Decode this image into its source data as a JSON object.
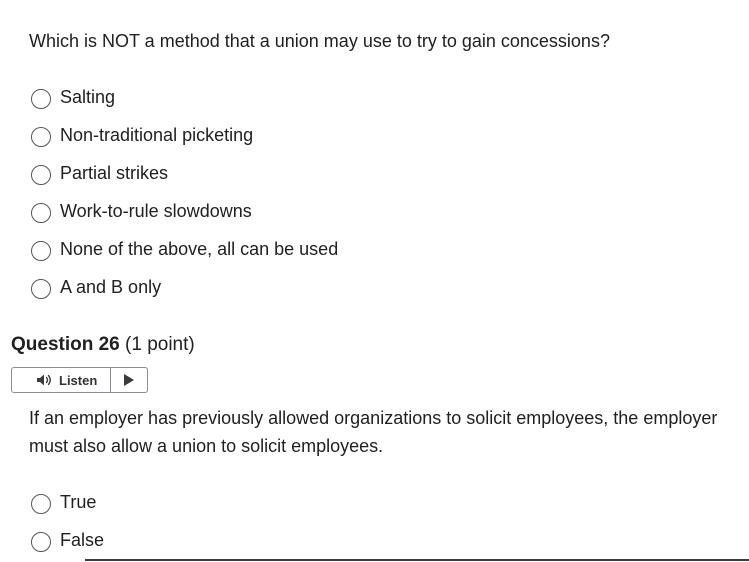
{
  "question1": {
    "prompt": "Which is NOT a method that a union may use to try to gain concessions?",
    "options": [
      "Salting",
      "Non-traditional picketing",
      "Partial strikes",
      "Work-to-rule slowdowns",
      "None of the above, all can be used",
      "A and B only"
    ]
  },
  "question2": {
    "title": "Question 26",
    "points": "(1 point)",
    "listen_label": "Listen",
    "listen_icon": "speaker-icon",
    "play_icon": "play-icon",
    "prompt": "If an employer has previously allowed organizations to solicit employees, the employer must also allow a union to solicit employees.",
    "options": [
      "True",
      "False"
    ]
  }
}
